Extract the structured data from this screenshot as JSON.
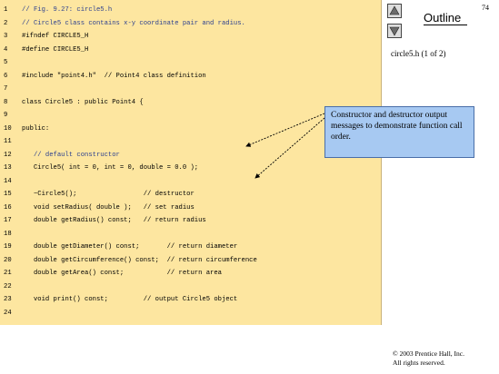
{
  "page_number": "74",
  "outline_title": "Outline",
  "subtitle": "circle5.h (1 of 2)",
  "callout_text": "Constructor and destructor output messages to demonstrate function call order.",
  "copyright_line1": "© 2003 Prentice Hall, Inc.",
  "copyright_line2": "All rights reserved.",
  "icons": {
    "up": "up-arrow-icon",
    "down": "down-arrow-icon"
  },
  "code_lines": [
    {
      "n": "1",
      "code": "// Fig. 9.27: circle5.h"
    },
    {
      "n": "2",
      "code": "// Circle5 class contains x-y coordinate pair and radius."
    },
    {
      "n": "3",
      "code": "#ifndef CIRCLE5_H"
    },
    {
      "n": "4",
      "code": "#define CIRCLE5_H"
    },
    {
      "n": "5",
      "code": ""
    },
    {
      "n": "6",
      "code": "#include \"point4.h\"  // Point4 class definition"
    },
    {
      "n": "7",
      "code": ""
    },
    {
      "n": "8",
      "code": "class Circle5 : public Point4 {"
    },
    {
      "n": "9",
      "code": ""
    },
    {
      "n": "10",
      "code": "public:"
    },
    {
      "n": "11",
      "code": ""
    },
    {
      "n": "12",
      "code": "   // default constructor"
    },
    {
      "n": "13",
      "code": "   Circle5( int = 0, int = 0, double = 0.0 );"
    },
    {
      "n": "14",
      "code": ""
    },
    {
      "n": "15",
      "code": "   ~Circle5();                 // destructor"
    },
    {
      "n": "16",
      "code": "   void setRadius( double );   // set radius"
    },
    {
      "n": "17",
      "code": "   double getRadius() const;   // return radius"
    },
    {
      "n": "18",
      "code": ""
    },
    {
      "n": "19",
      "code": "   double getDiameter() const;       // return diameter"
    },
    {
      "n": "20",
      "code": "   double getCircumference() const;  // return circumference"
    },
    {
      "n": "21",
      "code": "   double getArea() const;           // return area"
    },
    {
      "n": "22",
      "code": ""
    },
    {
      "n": "23",
      "code": "   void print() const;         // output Circle5 object"
    },
    {
      "n": "24",
      "code": ""
    }
  ]
}
